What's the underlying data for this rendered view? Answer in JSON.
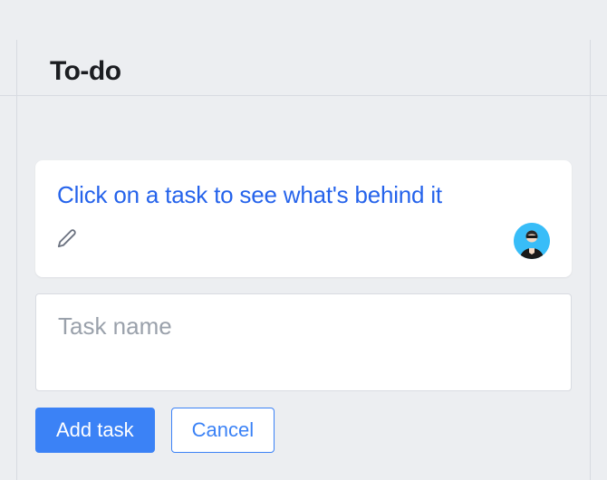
{
  "column": {
    "title": "To-do"
  },
  "card": {
    "title": "Click on a task to see what's behind it"
  },
  "new_task": {
    "placeholder": "Task name"
  },
  "buttons": {
    "add": "Add task",
    "cancel": "Cancel"
  }
}
